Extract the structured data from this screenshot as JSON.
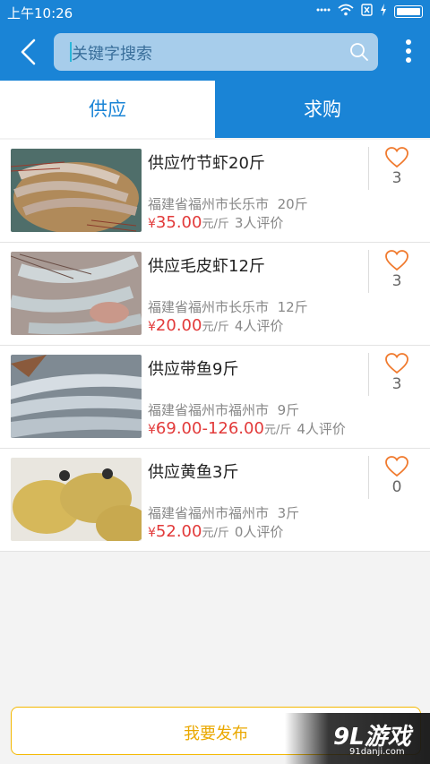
{
  "status_bar": {
    "time": "上午10:26",
    "icons": [
      "signal-icon",
      "wifi-icon",
      "sim-x-icon",
      "charging-icon",
      "battery-icon"
    ]
  },
  "search": {
    "placeholder": "关键字搜索"
  },
  "tabs": [
    {
      "label": "供应",
      "active": true
    },
    {
      "label": "求购",
      "active": false
    }
  ],
  "items": [
    {
      "title": "供应竹节虾20斤",
      "location": "福建省福州市长乐市",
      "quantity": "20斤",
      "currency": "¥",
      "price": "35.00",
      "unit": "元/斤",
      "reviews": "3人评价",
      "likes": "3"
    },
    {
      "title": "供应毛皮虾12斤",
      "location": "福建省福州市长乐市",
      "quantity": "12斤",
      "currency": "¥",
      "price": "20.00",
      "unit": "元/斤",
      "reviews": "4人评价",
      "likes": "3"
    },
    {
      "title": "供应带鱼9斤",
      "location": "福建省福州市福州市",
      "quantity": "9斤",
      "currency": "¥",
      "price": "69.00-126.00",
      "unit": "元/斤",
      "reviews": "4人评价",
      "likes": "3"
    },
    {
      "title": "供应黄鱼3斤",
      "location": "福建省福州市福州市",
      "quantity": "3斤",
      "currency": "¥",
      "price": "52.00",
      "unit": "元/斤",
      "reviews": "0人评价",
      "likes": "0"
    }
  ],
  "publish_button": {
    "label": "我要发布"
  },
  "watermark": {
    "brand": "9L游戏",
    "url": "91danji.com"
  },
  "colors": {
    "primary": "#1a84d6",
    "price": "#e23a3a",
    "heart": "#f07a2e",
    "publish": "#f3b800"
  }
}
